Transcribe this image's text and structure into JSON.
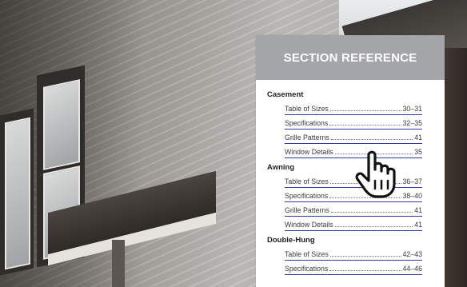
{
  "panel": {
    "title": "SECTION REFERENCE",
    "groups": [
      {
        "title": "Casement",
        "items": [
          {
            "label": "Table of Sizes",
            "page": "30–31"
          },
          {
            "label": "Specifications",
            "page": "32–35"
          },
          {
            "label": "Grille Patterns",
            "page": "41"
          },
          {
            "label": "Window Details",
            "page": "35"
          }
        ]
      },
      {
        "title": "Awning",
        "items": [
          {
            "label": "Table of Sizes",
            "page": "36–37"
          },
          {
            "label": "Specifications",
            "page": "38–40"
          },
          {
            "label": "Grille Patterns",
            "page": "41"
          },
          {
            "label": "Window Details",
            "page": "41"
          }
        ]
      },
      {
        "title": "Double-Hung",
        "items": [
          {
            "label": "Table of Sizes",
            "page": "42–43"
          },
          {
            "label": "Specifications",
            "page": "44–46"
          }
        ]
      }
    ]
  },
  "cursor": {
    "icon": "hand-pointer-icon"
  },
  "colors": {
    "header_bg": "#a3a5a8",
    "link_underline": "#2d3fa0"
  }
}
